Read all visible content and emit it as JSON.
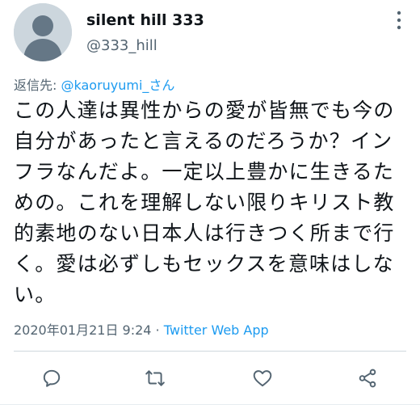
{
  "author": {
    "display_name": "silent hill 333",
    "handle": "@333_hill",
    "avatar_icon": "default-avatar-icon"
  },
  "reply": {
    "prefix": "返信先: ",
    "mention": "@kaoruyumi_さん"
  },
  "tweet": {
    "text": "この人達は異性からの愛が皆無でも今の自分があったと言えるのだろうか？インフラなんだよ。一定以上豊かに生きるための。これを理解しない限りキリスト教的素地のない日本人は行きつく所まで行く。愛は必ずしもセックスを意味はしない。"
  },
  "meta": {
    "timestamp": "2020年01月21日 9:24",
    "separator": " · ",
    "source": "Twitter Web App"
  },
  "actions": {
    "reply_icon": "reply-icon",
    "retweet_icon": "retweet-icon",
    "like_icon": "heart-icon",
    "share_icon": "share-icon"
  },
  "colors": {
    "accent": "#1d9bf0",
    "secondary_text": "#536471",
    "icon": "#536471",
    "avatar_bg": "#ccd6dd"
  }
}
